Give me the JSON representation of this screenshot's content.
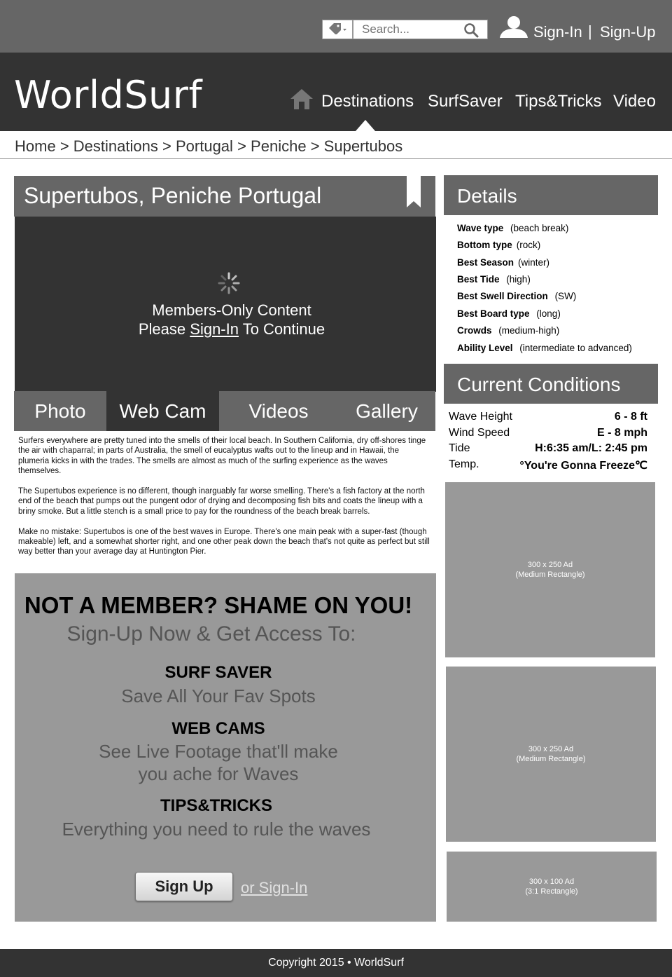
{
  "topbar": {
    "search_placeholder": "Search...",
    "signin_label": "Sign-In",
    "separator": "|",
    "signup_label": "Sign-Up"
  },
  "header": {
    "logo": "WorldSurf",
    "nav": [
      "Destinations",
      "SurfSaver",
      "Tips&Tricks",
      "Video"
    ],
    "active_nav": "Destinations"
  },
  "breadcrumb": [
    "Home",
    "Destinations",
    "Portugal",
    "Peniche",
    "Supertubos"
  ],
  "breadcrumb_sep": ">",
  "spot": {
    "title": "Supertubos, Peniche Portugal",
    "members_line1": "Members-Only Content",
    "members_prefix": "Please ",
    "members_link": "Sign-In",
    "members_suffix": " To Continue"
  },
  "tabs": [
    "Photo",
    "Web Cam",
    "Videos",
    "Gallery"
  ],
  "active_tab": "Web Cam",
  "article": [
    "Surfers everywhere are pretty tuned into the smells of their local beach. In Southern California, dry off-shores tinge the air with chaparral; in parts of Australia, the smell of eucalyptus wafts out to the lineup and in Hawaii, the plumeria kicks in with the trades. The smells are almost as much of the surfing experience as the waves themselves.",
    "The Supertubos experience is no different, though inarguably far worse smelling. There's a fish factory at the north end of the beach that pumps out the pungent odor of drying and decomposing fish bits and coats the lineup with a briny smoke. But a little stench is a small price to pay for the roundness of the beach break barrels.",
    "Make no mistake: Supertubos is one of the best waves in Europe. There's one main peak with a super-fast (though makeable) left, and a somewhat shorter right, and one other peak down the beach that's not quite as perfect but still way better than your average day at Huntington Pier."
  ],
  "promo": {
    "headline": "NOT A MEMBER? SHAME ON YOU!",
    "sub": "Sign-Up Now & Get Access To:",
    "features": [
      {
        "title": "SURF SAVER",
        "desc1": "Save All Your Fav Spots",
        "desc2": ""
      },
      {
        "title": "WEB CAMS",
        "desc1": "See Live Footage that'll make",
        "desc2": "you ache for Waves"
      },
      {
        "title": "TIPS&TRICKS",
        "desc1": "Everything you need to rule the waves",
        "desc2": ""
      }
    ],
    "signup_button": "Sign Up",
    "or_signin": "or Sign-In"
  },
  "details": {
    "title": "Details",
    "rows": [
      {
        "label": "Wave type",
        "value": "(beach break)"
      },
      {
        "label": "Bottom type",
        "value": "(rock)"
      },
      {
        "label": "Best Season",
        "value": "(winter)"
      },
      {
        "label": "Best Tide",
        "value": "(high)"
      },
      {
        "label": "Best Swell Direction",
        "value": "(SW)"
      },
      {
        "label": "Best Board type",
        "value": "(long)"
      },
      {
        "label": "Crowds",
        "value": "(medium-high)"
      },
      {
        "label": "Ability Level",
        "value": "(intermediate to advanced)"
      }
    ]
  },
  "conditions": {
    "title": "Current Conditions",
    "rows": [
      {
        "label": "Wave Height",
        "value": "6 - 8 ft"
      },
      {
        "label": "Wind Speed",
        "value": "E - 8 mph"
      },
      {
        "label": "Tide",
        "value": "H:6:35 am/L: 2:45 pm"
      },
      {
        "label": "Temp.",
        "value": "°You're Gonna Freeze℃"
      }
    ]
  },
  "ads": [
    {
      "line1": "300 x 250 Ad",
      "line2": "(Medium Rectangle)"
    },
    {
      "line1": "300 x 250 Ad",
      "line2": "(Medium Rectangle)"
    },
    {
      "line1": "300 x 100 Ad",
      "line2": "(3:1 Rectangle)"
    }
  ],
  "footer": "Copyright 2015 • WorldSurf",
  "icons": {
    "tag": "tag-dropdown-icon",
    "search": "search-icon",
    "user": "user-icon",
    "home": "home-icon",
    "bookmark": "bookmark-icon",
    "spinner": "loading-spinner-icon"
  }
}
